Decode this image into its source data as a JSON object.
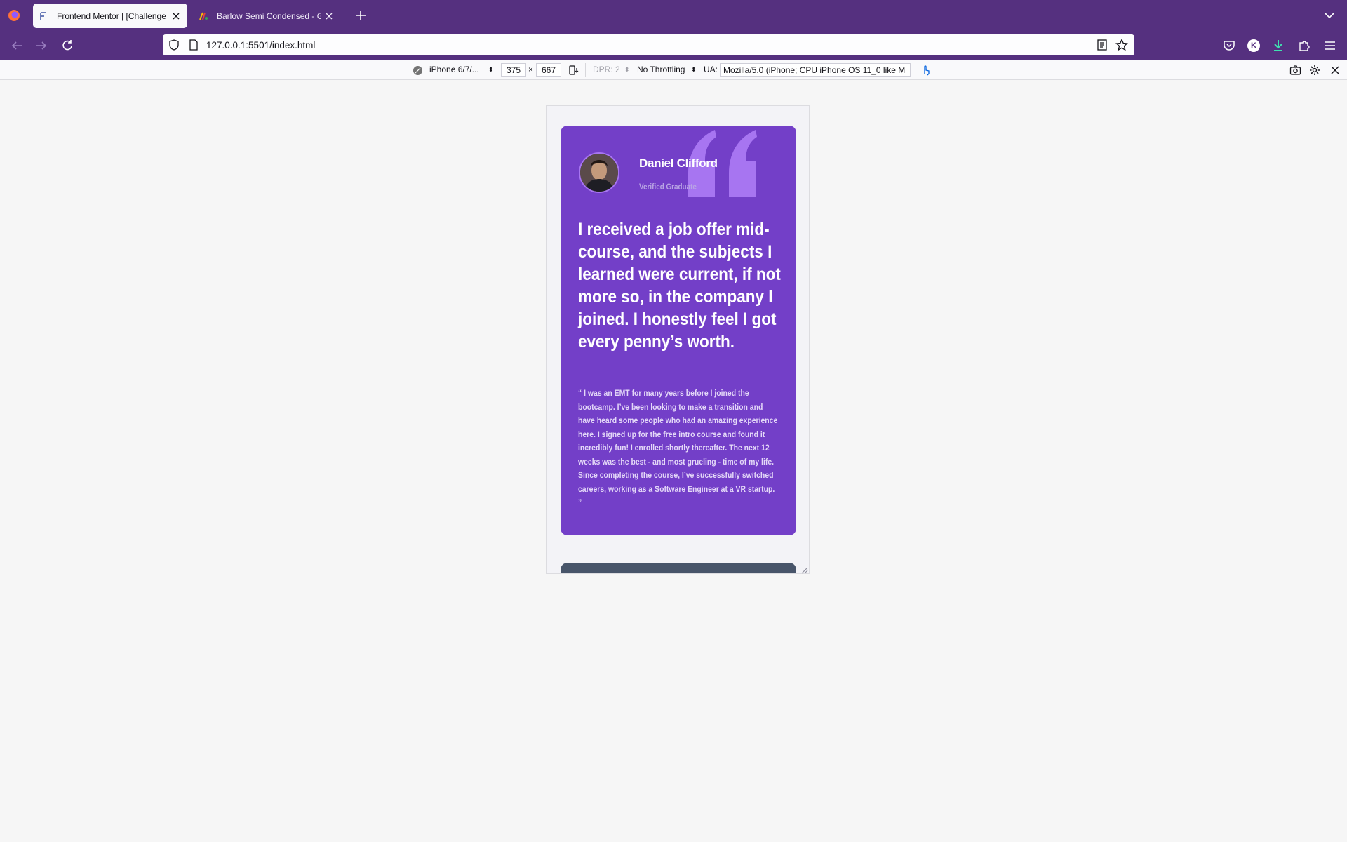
{
  "browser": {
    "tabs": [
      {
        "title": "Frontend Mentor | [Challenge N",
        "active": true
      },
      {
        "title": "Barlow Semi Condensed - Goog",
        "active": false
      }
    ],
    "url": "127.0.0.1:5501/index.html",
    "account_initial": "K"
  },
  "rdm": {
    "device": "iPhone 6/7/...",
    "width": "375",
    "times": "×",
    "height": "667",
    "dpr": "DPR: 2",
    "throttling": "No Throttling",
    "ua_label": "UA:",
    "ua_value": "Mozilla/5.0 (iPhone; CPU iPhone OS 11_0 like M"
  },
  "testimonial": {
    "name": "Daniel Clifford",
    "role": "Verified Graduate",
    "headline": "I received a job offer mid-course, and the subjects I learned were current, if not more so, in the company I joined. I honestly feel I got every penny’s worth.",
    "body": "“ I was an EMT for many years before I joined the bootcamp. I’ve been looking to make a transition and have heard some people who had an amazing experience here. I signed up for the free intro course and found it incredibly fun! I enrolled shortly thereafter. The next 12 weeks was the best - and most grueling - time of my life. Since completing the course, I’ve successfully switched careers, working as a Software Engineer at a VR startup. ”"
  },
  "colors": {
    "browser_chrome": "#55307f",
    "page_background": "#f6f6f6",
    "card_purple": "#733fc8",
    "quote_mark": "#a775f1",
    "next_card": "#48556a"
  }
}
